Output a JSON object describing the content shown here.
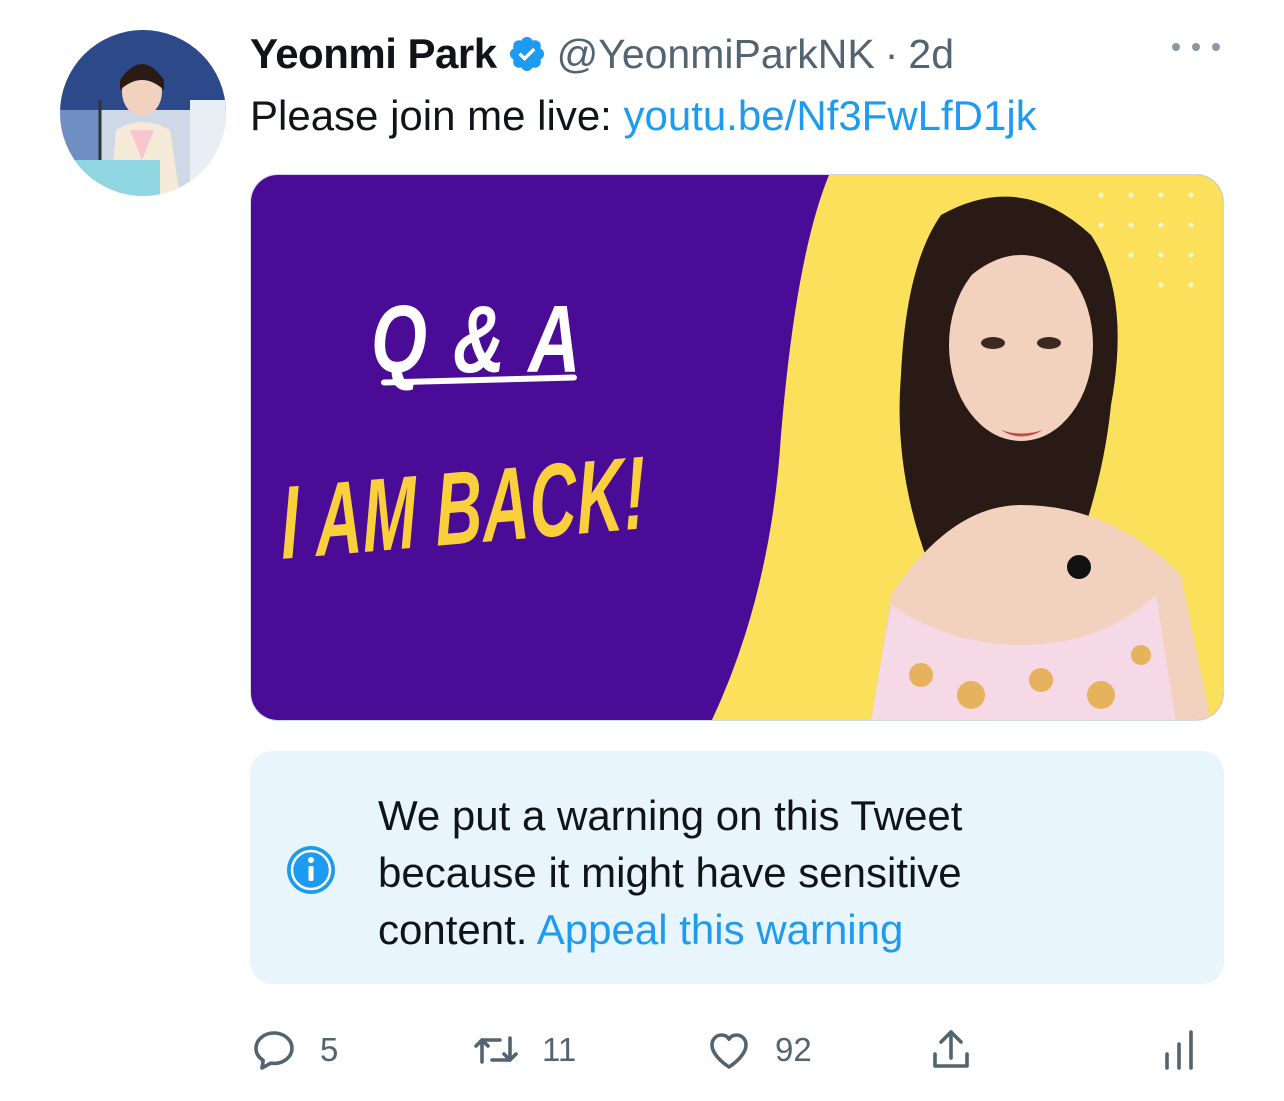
{
  "tweet": {
    "display_name": "Yeonmi Park",
    "handle": "@YeonmiParkNK",
    "separator": "·",
    "time": "2d",
    "text_prefix": "Please join me live: ",
    "link_text": "youtu.be/Nf3FwLfD1jk"
  },
  "media": {
    "headline_1": "Q & A",
    "headline_2": "I AM BACK!",
    "colors": {
      "left_bg": "#4a0c96",
      "right_bg": "#fbe05c",
      "headline_2": "#f9cf3b"
    }
  },
  "warning": {
    "text": "We put a warning on this Tweet because it might have sensitive content. ",
    "link_text": "Appeal this warning"
  },
  "actions": {
    "replies": "5",
    "retweets": "11",
    "likes": "92"
  },
  "icons": [
    "verified-badge-icon",
    "more-icon",
    "info-icon",
    "reply-icon",
    "retweet-icon",
    "like-icon",
    "share-icon",
    "analytics-icon"
  ],
  "colors": {
    "accent": "#1d9bf0",
    "muted": "#536471",
    "warning_bg": "#e8f5fd"
  }
}
